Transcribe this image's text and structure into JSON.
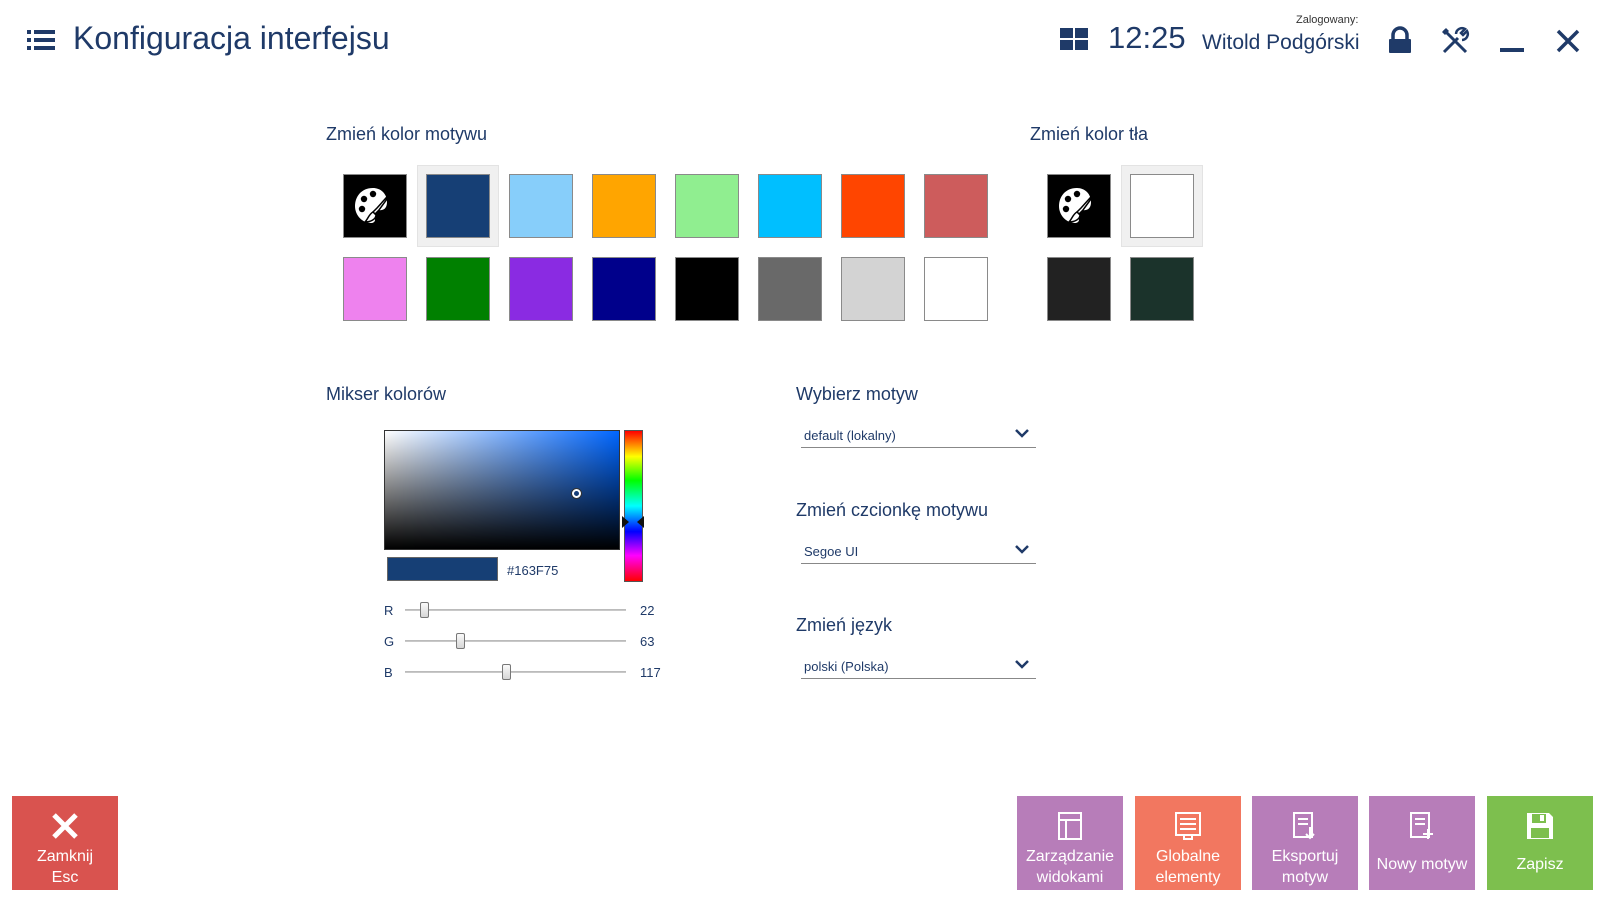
{
  "header": {
    "title": "Konfiguracja interfejsu",
    "time": "12:25",
    "logged_label": "Zalogowany:",
    "user_name": "Witold Podgórski"
  },
  "theme_color": {
    "label": "Zmień kolor motywu",
    "selected": "#163F75",
    "swatches": [
      [
        "custom",
        "#163F75",
        "#87CEFA",
        "#FFA500",
        "#90EE90",
        "#00BFFF",
        "#FF4500",
        "#CD5C5C"
      ],
      [
        "#EE82EE",
        "#008000",
        "#8A2BE2",
        "#00008B",
        "#000000",
        "#696969",
        "#D3D3D3",
        "#FFFFFF"
      ]
    ]
  },
  "background_color": {
    "label": "Zmień kolor tła",
    "selected": "#FFFFFF",
    "swatches": [
      [
        "custom",
        "#FFFFFF"
      ],
      [
        "#222222",
        "#1B332B"
      ]
    ]
  },
  "mixer": {
    "label": "Mikser kolorów",
    "hex": "#163F75",
    "r_label": "R",
    "g_label": "G",
    "b_label": "B",
    "r": "22",
    "g": "63",
    "b": "117"
  },
  "theme_select": {
    "label": "Wybierz motyw",
    "value": "default (lokalny)"
  },
  "font_select": {
    "label": "Zmień czcionkę motywu",
    "value": "Segoe UI"
  },
  "language_select": {
    "label": "Zmień język",
    "value": "polski (Polska)"
  },
  "actions": {
    "close": {
      "label": "Zamknij\nEsc",
      "color": "#D9534F"
    },
    "views": {
      "label": "Zarządzanie\nwidokami",
      "color": "#B77DB9"
    },
    "global": {
      "label": "Globalne\nelementy",
      "color": "#F27760"
    },
    "export": {
      "label": "Eksportuj\nmotyw",
      "color": "#B77DB9"
    },
    "new_theme": {
      "label": "Nowy motyw",
      "color": "#B77DB9"
    },
    "save": {
      "label": "Zapisz",
      "color": "#7DBF4E"
    }
  },
  "icons": [
    "menu-icon",
    "layout-grid-icon",
    "lock-icon",
    "tools-icon",
    "minimize-icon",
    "close-icon",
    "palette-icon",
    "chevron-down-icon",
    "save-icon"
  ]
}
